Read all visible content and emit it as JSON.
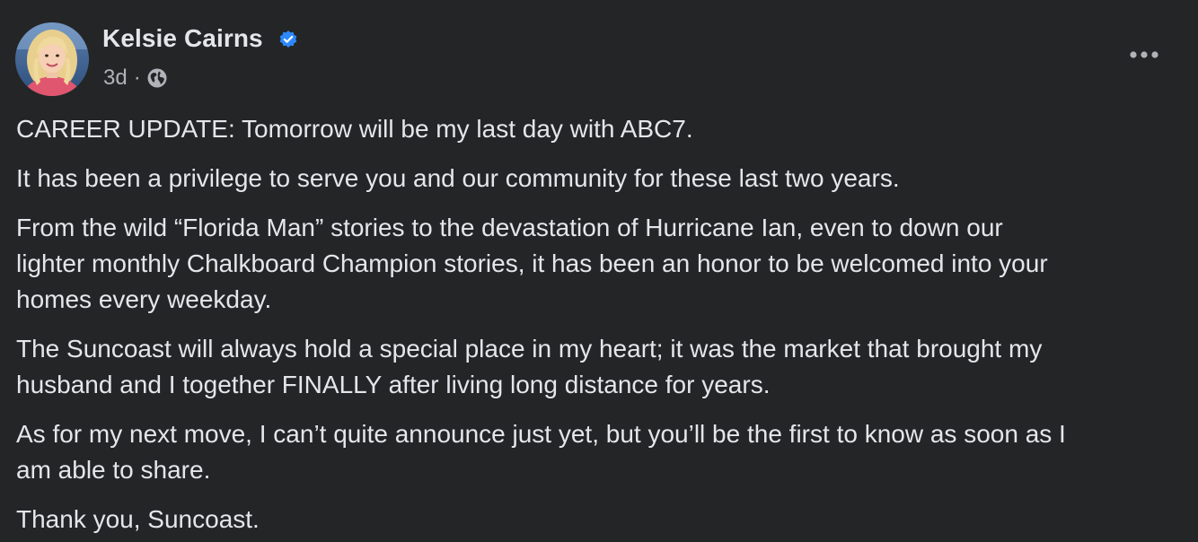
{
  "author": {
    "name": "Kelsie Cairns",
    "verified": true
  },
  "meta": {
    "time": "3d",
    "separator": "·",
    "audience_icon": "globe-icon"
  },
  "icons": {
    "verified": "verified-badge-icon",
    "more": "more-options-icon",
    "audience": "globe-icon"
  },
  "colors": {
    "background": "#242526",
    "text_primary": "#e4e6eb",
    "text_secondary": "#b0b3b8",
    "verified_blue": "#2d88ff"
  },
  "post": {
    "paragraphs": [
      {
        "lines": [
          "CAREER UPDATE: Tomorrow will be my last day with ABC7."
        ]
      },
      {
        "lines": [
          "It has been a privilege to serve you and our community for these last two years."
        ]
      },
      {
        "lines": [
          "From the wild “Florida Man” stories to the devastation of Hurricane Ian, even to down our",
          "lighter monthly Chalkboard Champion stories, it has been an honor to be welcomed into your",
          "homes every weekday."
        ]
      },
      {
        "lines": [
          "The Suncoast will always hold a special place in my heart; it was the market that brought my",
          "husband and I together FINALLY after living long distance for years."
        ]
      },
      {
        "lines": [
          "As for my next move, I can’t quite announce just yet, but you’ll be the first to know as soon as I",
          "am able to share."
        ]
      },
      {
        "lines": [
          "Thank you, Suncoast."
        ]
      }
    ]
  }
}
